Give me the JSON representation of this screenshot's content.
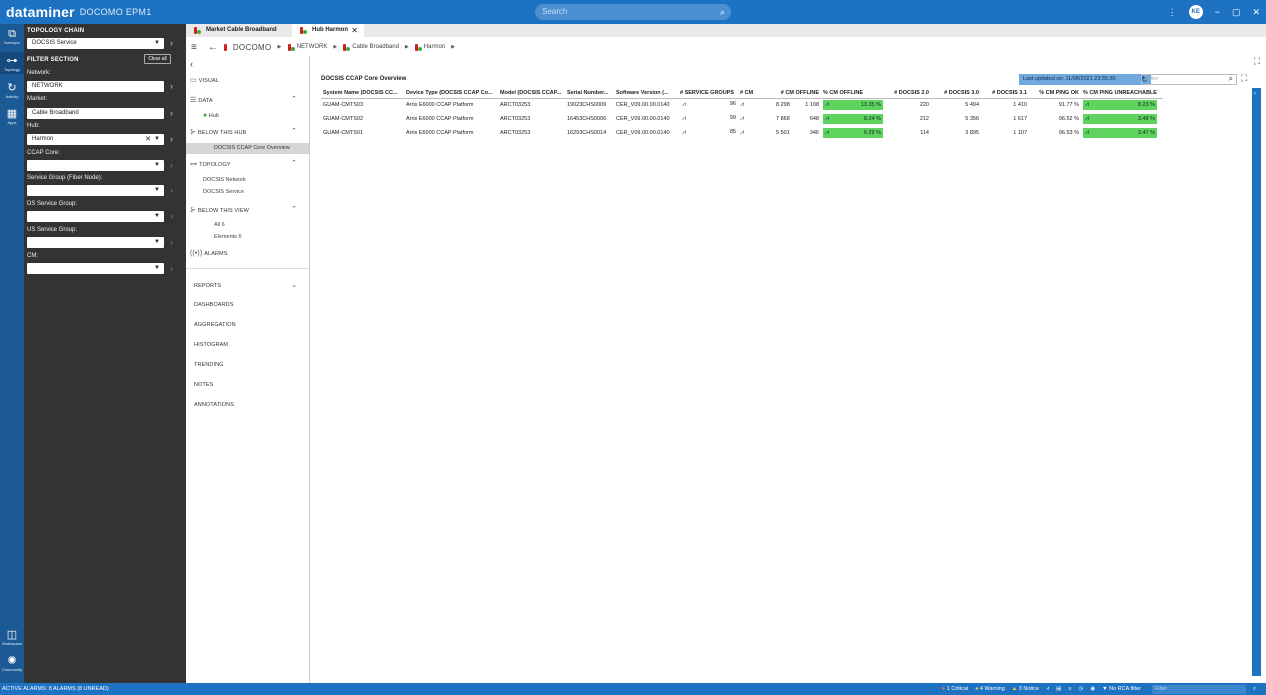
{
  "titlebar": {
    "brand": "dataminer",
    "system": "DOCOMO EPM1",
    "search_placeholder": "Search",
    "avatar": "KE",
    "window_controls": [
      "−",
      "▢",
      "✕"
    ],
    "menu_glyph": "⋮"
  },
  "rail": {
    "items": [
      {
        "label": "Surveyor",
        "icon": "surveyor-icon",
        "glyph": "⧉"
      },
      {
        "label": "Topology",
        "icon": "topology-icon",
        "glyph": "⊶"
      },
      {
        "label": "Activity",
        "icon": "activity-icon",
        "glyph": "↻"
      },
      {
        "label": "Apps",
        "icon": "apps-icon",
        "glyph": "▦"
      },
      {
        "label": "Workspace",
        "icon": "workspace-icon",
        "glyph": "◫"
      },
      {
        "label": "Community",
        "icon": "community-icon",
        "glyph": "✺"
      }
    ]
  },
  "filter_panel": {
    "topology_chain_heading": "TOPOLOGY CHAIN",
    "topology_chain_value": "DOCSIS Service",
    "filter_section_heading": "FILTER SECTION",
    "clear_all": "Clear all",
    "fields": [
      {
        "label": "Network:",
        "value": "NETWORK"
      },
      {
        "label": "Market:",
        "value": "Cable Broadband"
      },
      {
        "label": "Hub:",
        "value": "Harmon"
      },
      {
        "label": "CCAP Core:",
        "value": ""
      },
      {
        "label": "Service Group (Fiber Node):",
        "value": ""
      },
      {
        "label": "DS Service Group:",
        "value": ""
      },
      {
        "label": "US Service Group:",
        "value": ""
      },
      {
        "label": "CM:",
        "value": ""
      }
    ]
  },
  "tabs": [
    {
      "label": "Market Cable Broadband",
      "active": false
    },
    {
      "label": "Hub Harmon",
      "active": true
    }
  ],
  "breadcrumb": {
    "root": "DOCOMO",
    "items": [
      "NETWORK",
      "Cable Broadband",
      "Harmon"
    ]
  },
  "subnav": {
    "visual": "VISUAL",
    "data": "DATA",
    "data_item": "Hub",
    "below_hub": "BELOW THIS HUB",
    "selected": "DOCSIS CCAP Core Overview",
    "topology": "TOPOLOGY",
    "topology_items": [
      "DOCSIS Network",
      "DOCSIS Service"
    ],
    "below_view": "BELOW THIS VIEW",
    "below_view_items": [
      "All 6",
      "Elements 6"
    ],
    "alarms": "ALARMS",
    "reports": "REPORTS",
    "sections": [
      "DASHBOARDS",
      "AGGREGATION",
      "HISTOGRAM",
      "TRENDING",
      "NOTES",
      "ANNOTATIONS"
    ]
  },
  "main": {
    "title": "DOCSIS CCAP Core Overview",
    "last_updated": "Last updated on: 11/08/2021 23:35:30",
    "filter_placeholder": "Filter",
    "columns": [
      "System Name (DOCSIS CC...",
      "Device Type (DOCSIS CCAP Co...",
      "Model (DOCSIS CCAP...",
      "Serial Number...",
      "Software Version (...",
      "# SERVICE GROUPS",
      "# CM",
      "# CM OFFLINE",
      "% CM OFFLINE",
      "# DOCSIS 2.0",
      "# DOCSIS 3.0",
      "# DOCSIS 3.1",
      "% CM PING OK",
      "% CM PING UNREACHABLE"
    ],
    "rows": [
      {
        "system": "GUAM-CMTS03",
        "device": "Arris E6000 CCAP Platform",
        "model": "ARCT03253",
        "serial": "19023CHS0009",
        "software": "CER_V09.00.00.0140",
        "service_groups": "96",
        "cm": "8 298",
        "cm_offline": "1 108",
        "pct_offline": "13.35 %",
        "docsis20": "220",
        "docsis30": "5 494",
        "docsis31": "1 410",
        "ping_ok": "91.77 %",
        "ping_unreachable": "8.23 %"
      },
      {
        "system": "GUAM-CMTS02",
        "device": "Arris E6000 CCAP Platform",
        "model": "ARCT03253",
        "serial": "16453CHS0006",
        "software": "CER_V09.00.00.0140",
        "service_groups": "99",
        "cm": "7 868",
        "cm_offline": "648",
        "pct_offline": "8.24 %",
        "docsis20": "212",
        "docsis30": "5 356",
        "docsis31": "1 617",
        "ping_ok": "96.52 %",
        "ping_unreachable": "3.48 %"
      },
      {
        "system": "GUAM-CMTS01",
        "device": "Arris E6000 CCAP Platform",
        "model": "ARCT03253",
        "serial": "16293CHS0014",
        "software": "CER_V09.00.00.0140",
        "service_groups": "85",
        "cm": "5 501",
        "cm_offline": "346",
        "pct_offline": "6.29 %",
        "docsis20": "114",
        "docsis30": "3 895",
        "docsis31": "1 107",
        "ping_ok": "96.53 %",
        "ping_unreachable": "3.47 %"
      }
    ]
  },
  "statusbar": {
    "alarms": "ACTIVE ALARMS: 8 ALARMS (8 UNREAD)",
    "critical": "1 Critical",
    "warning": "4 Warning",
    "notice": "3 Notice",
    "rca": "No RCA filter",
    "filter_placeholder": "Filter"
  },
  "colors": {
    "accent": "#1d72c2",
    "panel_dark": "#333333",
    "good_bar": "#5ed35e"
  }
}
